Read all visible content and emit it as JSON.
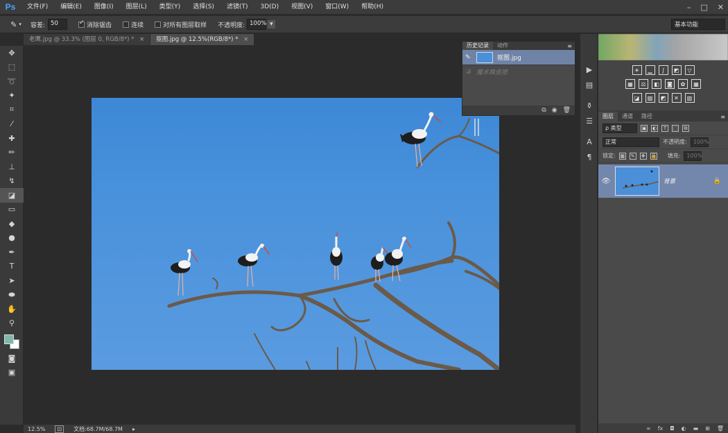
{
  "app": {
    "logo": "Ps"
  },
  "menu": [
    "文件(F)",
    "编辑(E)",
    "图像(I)",
    "图层(L)",
    "类型(Y)",
    "选择(S)",
    "滤镜(T)",
    "3D(D)",
    "视图(V)",
    "窗口(W)",
    "帮助(H)"
  ],
  "window_controls": [
    "–",
    "□",
    "✕"
  ],
  "options": {
    "tolerance_label": "容差:",
    "tolerance_value": "50",
    "antialias_label": "消除锯齿",
    "contiguous_label": "连续",
    "sample_all_label": "对所有图层取样",
    "opacity_label": "不透明度:",
    "opacity_value": "100%",
    "workspace": "基本功能"
  },
  "tabs": [
    {
      "label": "老鹰.jpg @ 33.3% (图层 0, RGB/8*) *",
      "close": "×"
    },
    {
      "label": "抠图.jpg @ 12.5%(RGB/8*) *",
      "close": "×"
    }
  ],
  "status": {
    "zoom": "12.5%",
    "doc_info": "文档:68.7M/68.7M"
  },
  "history_panel": {
    "tabs": [
      "历史记录",
      "动作"
    ],
    "menu": "≡",
    "snapshot_name": "抠图.jpg",
    "step_name": "魔术橡皮擦"
  },
  "layers_panel": {
    "tabs": [
      "图层",
      "通道",
      "路径"
    ],
    "filter_label": "ρ 类型",
    "blend_mode": "正常",
    "opacity_label": "不透明度:",
    "opacity_value": "100%",
    "lock_label": "锁定:",
    "fill_label": "填充:",
    "fill_value": "100%",
    "layer_name": "背景"
  }
}
